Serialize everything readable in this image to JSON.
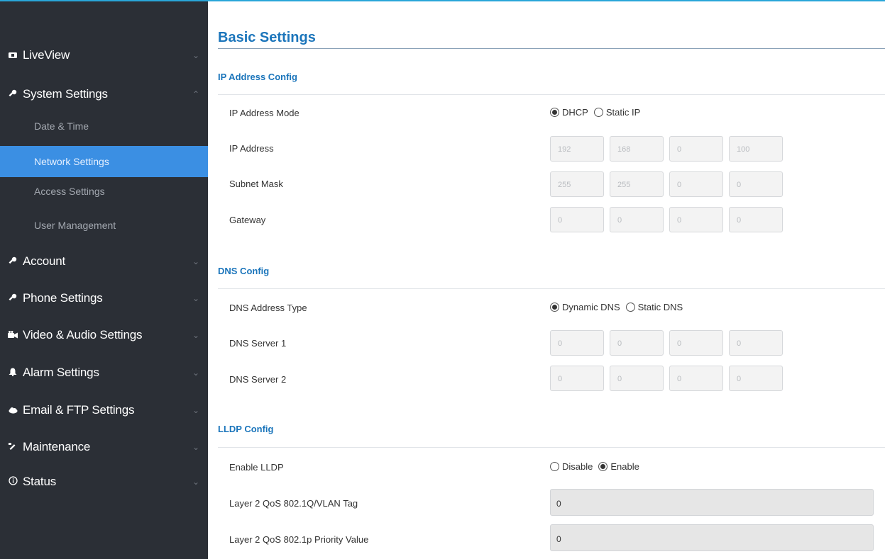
{
  "sidebar": {
    "items": [
      {
        "label": "LiveView",
        "icon": "video-icon",
        "glyph": "▬",
        "chevron": "⌄"
      },
      {
        "label": "System Settings",
        "icon": "wrench-icon",
        "glyph": "🔧",
        "chevron": "⌃"
      },
      {
        "label": "Account",
        "icon": "wrench-icon",
        "glyph": "🔧",
        "chevron": "⌄"
      },
      {
        "label": "Phone Settings",
        "icon": "wrench-icon",
        "glyph": "🔧",
        "chevron": "⌄"
      },
      {
        "label": "Video & Audio Settings",
        "icon": "camera-icon",
        "glyph": "📷",
        "chevron": "⌄"
      },
      {
        "label": "Alarm Settings",
        "icon": "bell-icon",
        "glyph": "🔔",
        "chevron": "⌄"
      },
      {
        "label": "Email & FTP Settings",
        "icon": "cloud-icon",
        "glyph": "☁",
        "chevron": "⌄"
      },
      {
        "label": "Maintenance",
        "icon": "tools-icon",
        "glyph": "🔨",
        "chevron": "⌄"
      },
      {
        "label": "Status",
        "icon": "info-icon",
        "glyph": "ⓘ",
        "chevron": "⌄"
      }
    ],
    "subitems": [
      {
        "label": "Date & Time"
      },
      {
        "label": "Network Settings"
      },
      {
        "label": "Access Settings"
      },
      {
        "label": "User Management"
      }
    ],
    "active_subitem": "Network Settings"
  },
  "main": {
    "title": "Basic Settings",
    "ip_section": {
      "title": "IP Address Config",
      "mode_label": "IP Address Mode",
      "mode_options": [
        {
          "label": "DHCP",
          "checked": true
        },
        {
          "label": "Static IP",
          "checked": false
        }
      ],
      "ip_label": "IP Address",
      "ip_values": [
        "192",
        "168",
        "0",
        "100"
      ],
      "mask_label": "Subnet Mask",
      "mask_values": [
        "255",
        "255",
        "0",
        "0"
      ],
      "gateway_label": "Gateway",
      "gateway_values": [
        "0",
        "0",
        "0",
        "0"
      ]
    },
    "dns_section": {
      "title": "DNS Config",
      "type_label": "DNS Address Type",
      "type_options": [
        {
          "label": "Dynamic DNS",
          "checked": true
        },
        {
          "label": "Static DNS",
          "checked": false
        }
      ],
      "server1_label": "DNS Server 1",
      "server1_values": [
        "0",
        "0",
        "0",
        "0"
      ],
      "server2_label": "DNS Server 2",
      "server2_values": [
        "0",
        "0",
        "0",
        "0"
      ]
    },
    "lldp_section": {
      "title": "LLDP Config",
      "enable_label": "Enable LLDP",
      "enable_options": [
        {
          "label": "Disable",
          "checked": false
        },
        {
          "label": "Enable",
          "checked": true
        }
      ],
      "vlan_label": "Layer 2 QoS 802.1Q/VLAN Tag",
      "vlan_value": "0",
      "priority_label": "Layer 2 QoS 802.1p Priority Value",
      "priority_value": "0"
    }
  },
  "colors": {
    "sidebar_bg": "#2b2f36",
    "active_item": "#3b8fe3",
    "accent": "#1b75bb",
    "top_border": "#29a6d9"
  }
}
